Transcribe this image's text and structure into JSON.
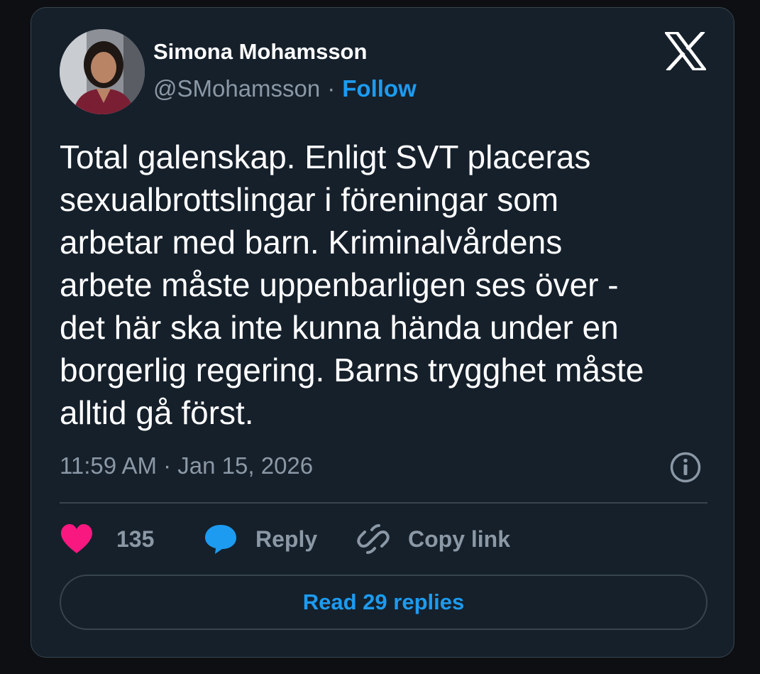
{
  "author": {
    "name": "Simona Mohamsson",
    "handle": "@SMohamsson",
    "separator": "·",
    "follow_label": "Follow"
  },
  "tweet": {
    "text": "Total galenskap. Enligt SVT placeras\nsexualbrottslingar i föreningar som\narbetar med barn. Kriminalvårdens\narbete måste uppenbarligen ses över -\ndet här ska inte kunna hända under en\nborgerlig regering. Barns trygghet måste\nalltid gå först.",
    "timestamp": "11:59 AM · Jan 15, 2026"
  },
  "actions": {
    "like_count": "135",
    "reply_label": "Reply",
    "copy_link_label": "Copy link"
  },
  "footer": {
    "read_replies_label": "Read 29 replies"
  },
  "icons": {
    "brand": "x-logo-icon",
    "info": "info-icon",
    "like": "heart-icon",
    "reply": "speech-bubble-icon",
    "copy": "link-icon"
  },
  "colors": {
    "background": "#15202b",
    "accent": "#1d9bf0",
    "like": "#f91880",
    "muted": "#8b98a5",
    "border": "#38444d"
  }
}
